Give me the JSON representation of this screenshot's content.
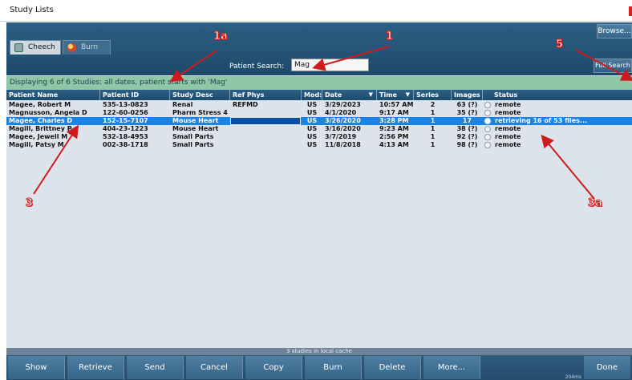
{
  "window": {
    "title": "Study Lists"
  },
  "tabs": [
    {
      "label": "Cheech",
      "icon": "folder-icon"
    },
    {
      "label": "Burn",
      "icon": "burn-disc-icon"
    }
  ],
  "search": {
    "label": "Patient Search:",
    "value": "Mag"
  },
  "buttons": {
    "browse": "Browse...",
    "full_search": "Full Search"
  },
  "status_text": "Displaying 6 of 6 Studies: all dates, patient starts with 'Mag'",
  "table": {
    "columns": [
      "Patient Name",
      "Patient ID",
      "Study Desc",
      "Ref Phys",
      "Mod:",
      "Date",
      "Time",
      "Series",
      "Images",
      "Status"
    ],
    "rows": [
      {
        "name": "Magee, Robert M",
        "id": "535-13-0823",
        "desc": "Renal",
        "ref": "REFMD",
        "mod": "US",
        "date": "3/29/2023",
        "time": "10:57 AM",
        "series": "2",
        "images": "63 (?)",
        "status": "remote"
      },
      {
        "name": "Magnusson, Angela D",
        "id": "122-60-0256",
        "desc": "Pharm Stress 4",
        "ref": "",
        "mod": "US",
        "date": "4/1/2020",
        "time": "9:17 AM",
        "series": "1",
        "images": "35 (?)",
        "status": "remote"
      },
      {
        "name": "Magee, Charles D",
        "id": "152-15-7107",
        "desc": "Mouse Heart",
        "ref": "",
        "mod": "US",
        "date": "3/26/2020",
        "time": "3:28 PM",
        "series": "1",
        "images": "17",
        "status": "retrieving 16 of 53 files..."
      },
      {
        "name": "Magill, Brittney P",
        "id": "404-23-1223",
        "desc": "Mouse Heart",
        "ref": "",
        "mod": "US",
        "date": "3/16/2020",
        "time": "9:23 AM",
        "series": "1",
        "images": "38 (?)",
        "status": "remote"
      },
      {
        "name": "Magee, Jewell M",
        "id": "532-18-4953",
        "desc": "Small Parts",
        "ref": "",
        "mod": "US",
        "date": "3/7/2019",
        "time": "2:56 PM",
        "series": "1",
        "images": "92 (?)",
        "status": "remote"
      },
      {
        "name": "Magill, Patsy M",
        "id": "002-38-1718",
        "desc": "Small Parts",
        "ref": "",
        "mod": "US",
        "date": "11/8/2018",
        "time": "4:13 AM",
        "series": "1",
        "images": "98 (?)",
        "status": "remote"
      }
    ]
  },
  "cache_note": "3 studies in local cache",
  "bottom_buttons": [
    "Show",
    "Retrieve",
    "Send",
    "Cancel",
    "Copy",
    "Burn",
    "Delete",
    "More...",
    "Done"
  ],
  "timing": "204ms",
  "annotations": [
    "1a",
    "1",
    "5",
    "3",
    "3a"
  ],
  "colors": {
    "accent": "#1a83e6",
    "header": "#2d5f84",
    "status_bar": "#8fc6a6",
    "annotation": "#cf1b1b"
  }
}
